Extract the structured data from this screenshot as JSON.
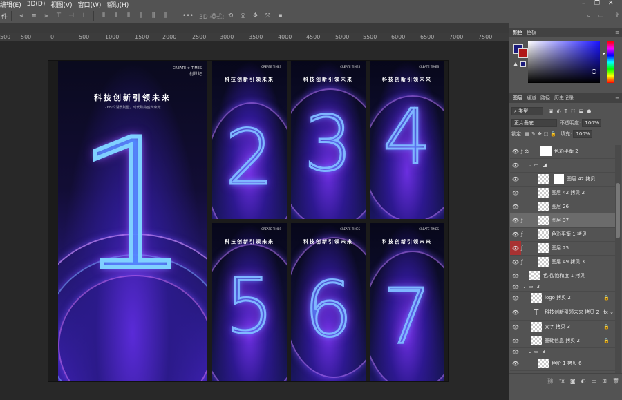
{
  "menu": {
    "items": [
      "编辑(E)",
      "3D(D)",
      "视图(V)",
      "窗口(W)",
      "帮助(H)"
    ]
  },
  "options_bar": {
    "left_label": "件",
    "mode_3d": "3D 模式:"
  },
  "ruler": {
    "ticks": [
      "500",
      "0",
      "500",
      "1000",
      "1500",
      "2000",
      "2500",
      "3000",
      "3500",
      "4000",
      "4500",
      "5000",
      "5500",
      "6000",
      "6500",
      "7000",
      "7500"
    ]
  },
  "big_poster": {
    "brand": "CREATE ★ TIMES",
    "brand_cn": "创世纪",
    "title": "科技创新引领未来",
    "subtitle": "268㎡ 湖景别墅，时代臻藏盛世荣光",
    "numeral": "1"
  },
  "posters": [
    {
      "title": "科技创新引领未来",
      "numeral": "2",
      "brand": "CREATE TIMES"
    },
    {
      "title": "科技创新引领未来",
      "numeral": "3",
      "brand": "CREATE TIMES"
    },
    {
      "title": "科技创新引领未来",
      "numeral": "4",
      "brand": "CREATE TIMES"
    },
    {
      "title": "科技创新引领未来",
      "numeral": "5",
      "brand": "CREATE TIMES"
    },
    {
      "title": "科技创新引领未来",
      "numeral": "6",
      "brand": "CREATE TIMES"
    },
    {
      "title": "科技创新引领未来",
      "numeral": "7",
      "brand": "CREATE TIMES"
    }
  ],
  "color_panel": {
    "tabs": [
      "颜色",
      "色板"
    ],
    "foreground": "#1b1b7a",
    "background": "#b01818"
  },
  "layers_panel": {
    "tabs": [
      "图层",
      "通道",
      "路径",
      "历史记录"
    ],
    "filter_label": "类型",
    "blend_mode": "正片叠底",
    "opacity_label": "不透明度:",
    "opacity_value": "100%",
    "lock_label": "锁定:",
    "fill_label": "填充:",
    "fill_value": "100%",
    "layers": [
      {
        "name": "色彩平衡 2",
        "selected": false,
        "thumb": "white",
        "red": false,
        "lock": false
      },
      {
        "name": "",
        "selected": false,
        "thumb": "folder",
        "red": false,
        "lock": false
      },
      {
        "name": "图层 42 拷贝",
        "selected": false,
        "thumb": "checker",
        "red": false,
        "lock": false
      },
      {
        "name": "图层 42 拷贝 2",
        "selected": false,
        "thumb": "checker",
        "red": false,
        "lock": false
      },
      {
        "name": "图层 26",
        "selected": false,
        "thumb": "checker",
        "red": false,
        "lock": false
      },
      {
        "name": "图层 37",
        "selected": true,
        "thumb": "checker",
        "red": false,
        "lock": false
      },
      {
        "name": "色彩平衡 1 拷贝",
        "selected": false,
        "thumb": "checker",
        "red": false,
        "lock": false
      },
      {
        "name": "图层 25",
        "selected": false,
        "thumb": "checker",
        "red": true,
        "lock": false
      },
      {
        "name": "图层 49 拷贝 3",
        "selected": false,
        "thumb": "checker",
        "red": false,
        "lock": false
      },
      {
        "name": "色相/饱和度 1 拷贝",
        "selected": false,
        "thumb": "checker",
        "red": false,
        "lock": false
      },
      {
        "name": "3",
        "selected": false,
        "thumb": "folder",
        "red": false,
        "lock": false
      },
      {
        "name": "logo 拷贝 2",
        "selected": false,
        "thumb": "checker",
        "red": false,
        "lock": true
      },
      {
        "name": "科技创新引领未来 拷贝 2",
        "selected": false,
        "thumb": "text",
        "red": false,
        "lock": false
      },
      {
        "name": "文字 拷贝 3",
        "selected": false,
        "thumb": "checker",
        "red": false,
        "lock": true
      },
      {
        "name": "基础信息 拷贝 2",
        "selected": false,
        "thumb": "checker",
        "red": false,
        "lock": true
      },
      {
        "name": "3",
        "selected": false,
        "thumb": "folder",
        "red": false,
        "lock": false
      },
      {
        "name": "色阶 1 拷贝 6",
        "selected": false,
        "thumb": "checker",
        "red": false,
        "lock": false
      }
    ]
  }
}
